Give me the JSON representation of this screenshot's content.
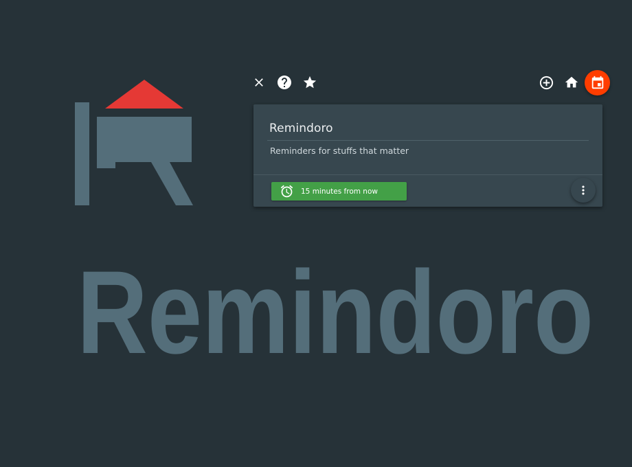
{
  "app": {
    "wordmark": "Remindoro"
  },
  "toolbar": {
    "left_icons": [
      "close-icon",
      "help-icon",
      "star-icon"
    ],
    "right_icons": [
      "add-circle-icon",
      "home-icon",
      "calendar-icon"
    ],
    "accent_color": "#ff3d00"
  },
  "card": {
    "title": "Remindoro",
    "description": "Reminders for stuffs that matter",
    "due_label": "15 minutes from now",
    "due_color": "#43a047",
    "menu_icon": "more-vertical-icon"
  },
  "colors": {
    "background": "#263238",
    "card": "#37474f",
    "logo_gray": "#546e7a",
    "logo_roof": "#e53935"
  }
}
